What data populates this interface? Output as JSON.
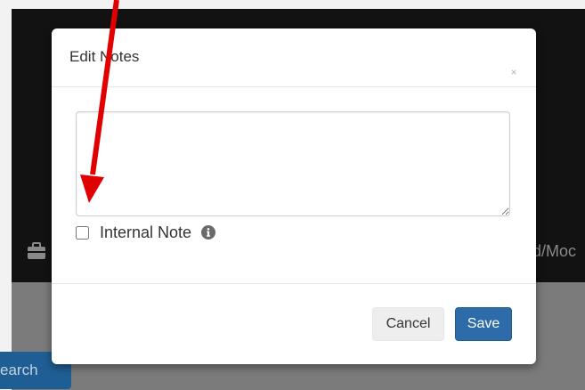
{
  "background": {
    "trailing_text": "d/Moc",
    "search_button_label": "earch"
  },
  "modal": {
    "title": "Edit Notes",
    "close_label": "×",
    "notes_value": "",
    "internal_note_label": "Internal Note",
    "internal_note_checked": false,
    "cancel_label": "Cancel",
    "save_label": "Save"
  },
  "colors": {
    "primary": "#2d6ca8",
    "annotation_arrow": "#e00000"
  },
  "icons": {
    "background_icon": "briefcase-icon",
    "info": "info-circle-icon"
  }
}
